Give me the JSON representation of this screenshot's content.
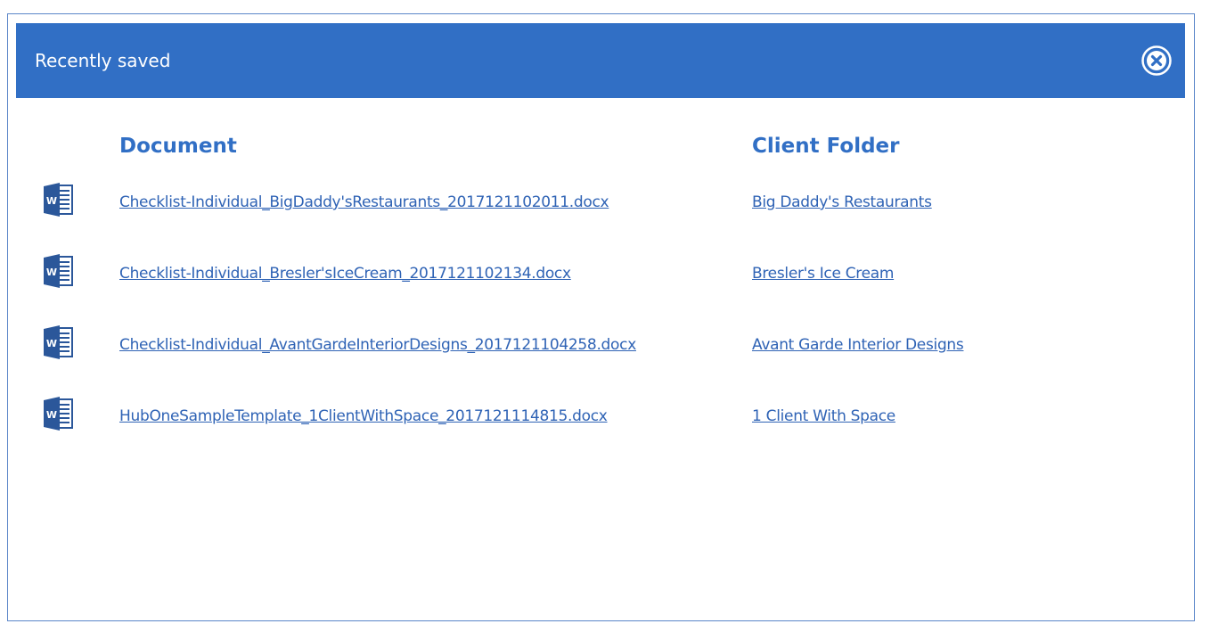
{
  "dialog": {
    "title": "Recently saved",
    "close_icon": "close-circle-icon"
  },
  "columns": {
    "document": "Document",
    "client_folder": "Client Folder"
  },
  "colors": {
    "header_bg": "#316fc5",
    "link": "#2f63b5",
    "word_icon": "#2b579a"
  },
  "rows": [
    {
      "icon": "word-document-icon",
      "document": "Checklist-Individual_BigDaddy'sRestaurants_2017121102011.docx",
      "client": "Big Daddy's Restaurants"
    },
    {
      "icon": "word-document-icon",
      "document": "Checklist-Individual_Bresler'sIceCream_2017121102134.docx",
      "client": "Bresler's Ice Cream"
    },
    {
      "icon": "word-document-icon",
      "document": "Checklist-Individual_AvantGardeInteriorDesigns_2017121104258.docx",
      "client": "Avant Garde Interior Designs"
    },
    {
      "icon": "word-document-icon",
      "document": "HubOneSampleTemplate_1ClientWithSpace_2017121114815.docx",
      "client": "1 Client With Space"
    }
  ]
}
